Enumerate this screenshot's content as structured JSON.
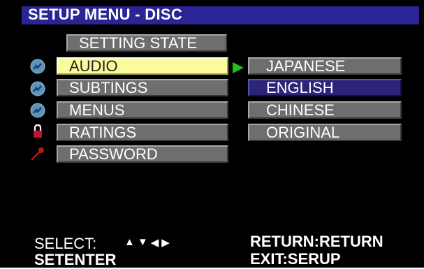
{
  "header": {
    "title": "SETUP MENU - DISC"
  },
  "menu": {
    "items": [
      {
        "label": "SETTING STATE",
        "icon": "none"
      },
      {
        "label": "AUDIO",
        "icon": "disc-icon"
      },
      {
        "label": "SUBTINGS",
        "icon": "disc-icon"
      },
      {
        "label": "MENUS",
        "icon": "disc-icon"
      },
      {
        "label": "RATINGS",
        "icon": "lock-icon"
      },
      {
        "label": "PASSWORD",
        "icon": "key-icon"
      }
    ],
    "selected": "AUDIO"
  },
  "submenu": {
    "options": [
      {
        "label": "JAPANESE"
      },
      {
        "label": "ENGLISH"
      },
      {
        "label": "CHINESE"
      },
      {
        "label": "ORIGINAL"
      }
    ],
    "highlighted": "ENGLISH"
  },
  "footer": {
    "select_label": "SELECT:",
    "nav_keys": [
      "▲",
      "▼",
      "◀",
      "▶"
    ],
    "enter_label": "SETENTER",
    "return_key": "RETURN",
    "return_action": "RETURN",
    "exit_key": "EXIT",
    "exit_action": "SERUP"
  },
  "colors": {
    "background": "#000000",
    "title_bar": "#2a2494",
    "button": "#6e6e6e",
    "selected_button": "#fbfb9c",
    "highlight_option": "#2c2478",
    "pointer": "#22c022"
  }
}
